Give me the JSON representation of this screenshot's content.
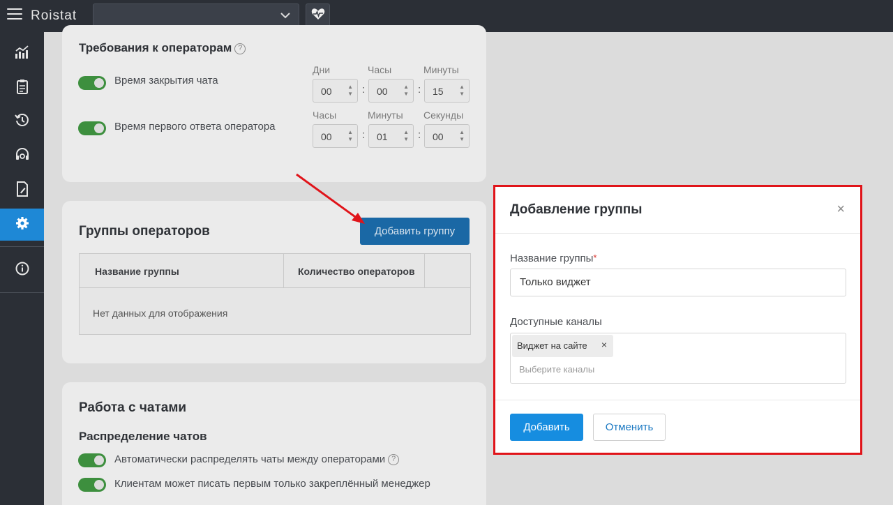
{
  "app": {
    "logo": "Roistat"
  },
  "topbar": {
    "project_select_value": ""
  },
  "sidebar": {
    "items": [
      {
        "icon": "analytics-icon"
      },
      {
        "icon": "clipboard-icon"
      },
      {
        "icon": "history-icon"
      },
      {
        "icon": "headset-icon"
      },
      {
        "icon": "document-edit-icon"
      },
      {
        "icon": "gear-icon",
        "active": true
      },
      {
        "icon": "info-icon"
      }
    ]
  },
  "requirements": {
    "title": "Требования к операторам",
    "help": "?",
    "rows": [
      {
        "label": "Время закрытия чата",
        "units": [
          "Дни",
          "Часы",
          "Минуты"
        ],
        "values": [
          "00",
          "00",
          "15"
        ]
      },
      {
        "label": "Время первого ответа оператора",
        "units": [
          "Часы",
          "Минуты",
          "Секунды"
        ],
        "values": [
          "00",
          "01",
          "00"
        ]
      }
    ]
  },
  "groups": {
    "title": "Группы операторов",
    "add_button": "Добавить группу",
    "columns": [
      "Название группы",
      "Количество операторов"
    ],
    "empty_text": "Нет данных для отображения"
  },
  "chats": {
    "title": "Работа с чатами",
    "subtitle": "Распределение чатов",
    "options": [
      "Автоматически распределять чаты между операторами",
      "Клиентам может писать первым только закреплённый менеджер"
    ]
  },
  "modal": {
    "title": "Добавление группы",
    "close": "×",
    "name_label": "Название группы",
    "required_mark": "*",
    "name_value": "Только виджет",
    "channels_label": "Доступные каналы",
    "channel_chip": "Виджет на сайте",
    "chip_remove": "×",
    "channels_placeholder": "Выберите каналы",
    "submit": "Добавить",
    "cancel": "Отменить"
  },
  "colors": {
    "highlight_border": "#e0141a",
    "arrow": "#e0141a",
    "primary": "#168de0",
    "toggle_on": "#3d8f3e"
  }
}
